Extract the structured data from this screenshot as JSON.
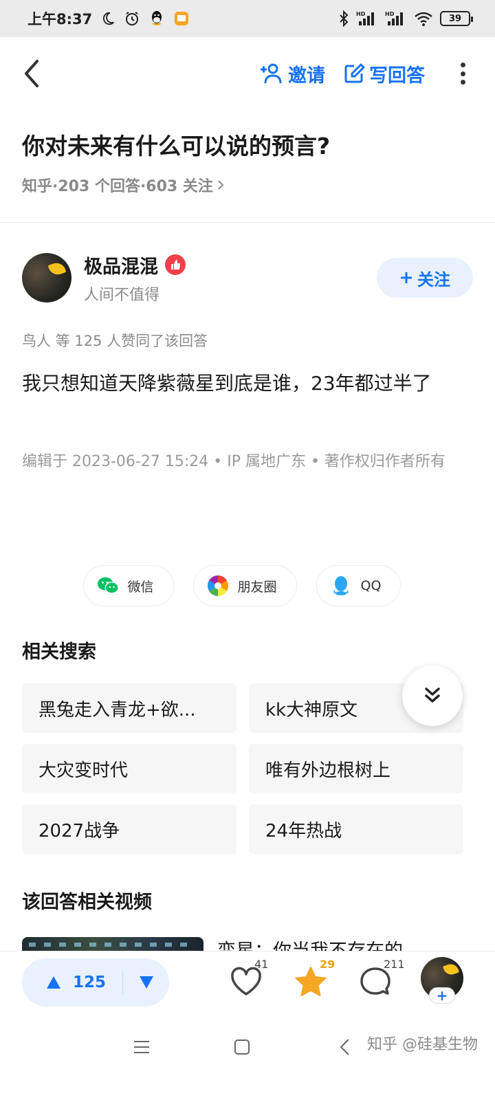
{
  "status_bar": {
    "time": "上午8:37",
    "battery": "39",
    "icons": [
      "moon-icon",
      "alarm-icon",
      "qq-notify-icon",
      "app-notify-icon",
      "bluetooth-icon",
      "hd-signal-icon",
      "hd-signal-icon",
      "wifi-icon",
      "battery-icon"
    ]
  },
  "nav": {
    "invite_label": "邀请",
    "write_answer_label": "写回答"
  },
  "question": {
    "title": "你对未来有什么可以说的预言?",
    "meta": "知乎·203 个回答·603 关注"
  },
  "author": {
    "name": "极品混混",
    "bio": "人间不值得",
    "follow_label": "关注"
  },
  "answer": {
    "upvote_line": "鸟人 等 125 人赞同了该回答",
    "text": "我只想知道天降紫薇星到底是谁，23年都过半了",
    "edit_meta": "编辑于 2023-06-27 15:24 • IP 属地广东 • 著作权归作者所有"
  },
  "share": {
    "wechat": "微信",
    "moments": "朋友圈",
    "qq": "QQ"
  },
  "related": {
    "title": "相关搜索",
    "items": [
      "黑兔走入青龙+欲...",
      "kk大神原文",
      "大灾变时代",
      "唯有外边根树上",
      "2027战争",
      "24年热战"
    ]
  },
  "videos": {
    "title": "该回答相关视频",
    "first_title": "变星：你当我不存在的"
  },
  "action_bar": {
    "upvotes": "125",
    "likes": "41",
    "favorites": "29",
    "comments": "211",
    "accent": "#1772f6",
    "favorite_color": "#f5a623"
  },
  "watermark": "知乎 @硅基生物"
}
